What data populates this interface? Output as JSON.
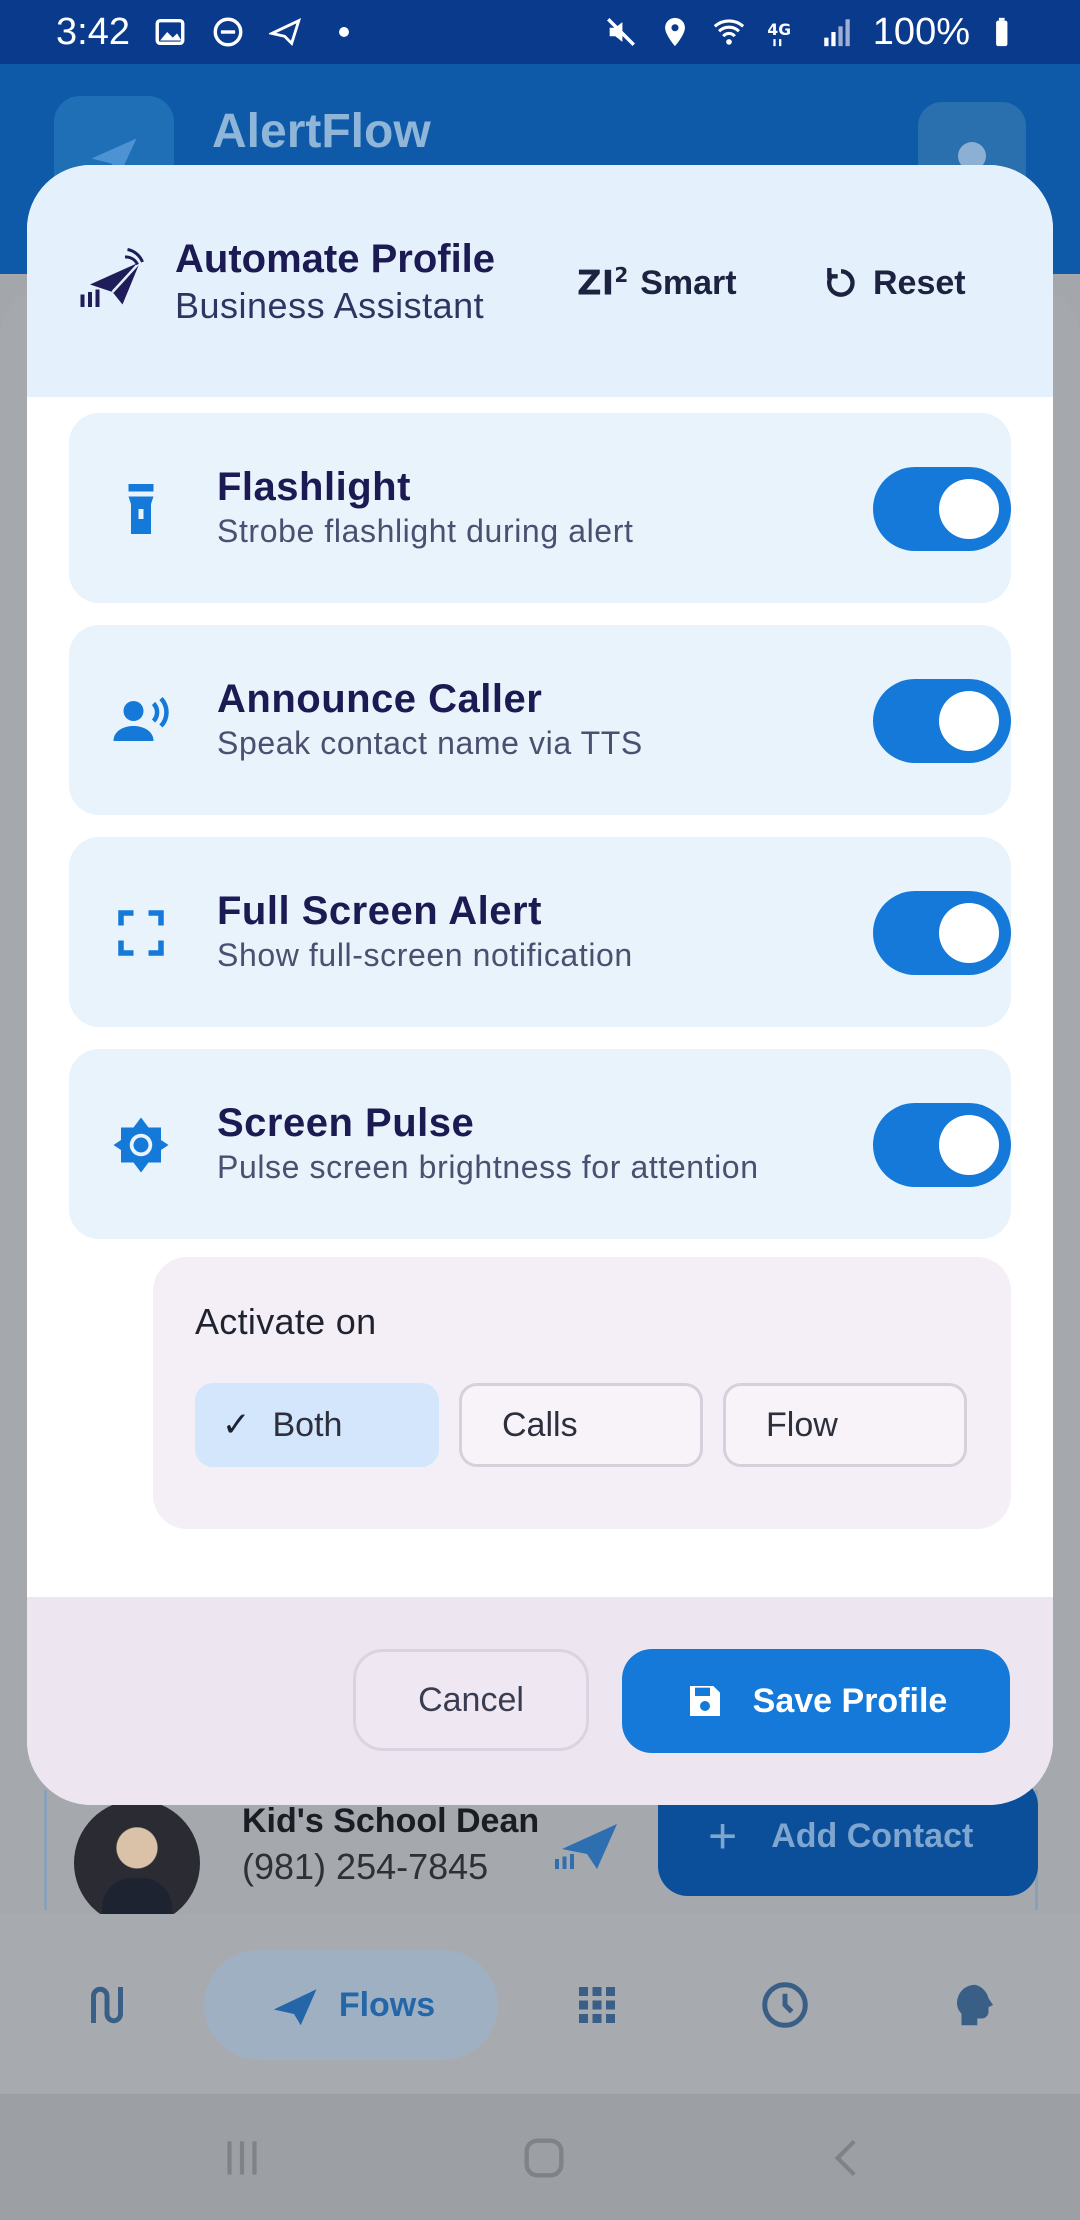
{
  "status_bar": {
    "time": "3:42",
    "battery": "100%",
    "left_icons": [
      "gallery-icon",
      "dnd-icon",
      "plane-app-icon",
      "dot-icon"
    ],
    "right_icons": [
      "mute-icon",
      "location-icon",
      "wifi-icon",
      "lte-icon",
      "signal-icon",
      "battery-icon"
    ]
  },
  "app": {
    "title": "AlertFlow"
  },
  "dialog": {
    "title": "Automate Profile",
    "subtitle": "Business Assistant",
    "smart_mark": "ZI",
    "smart_sup": "2",
    "smart_label": "Smart",
    "reset_label": "Reset",
    "features": [
      {
        "title": "Flashlight",
        "description": "Strobe flashlight during alert",
        "enabled": true,
        "icon": "flashlight-icon"
      },
      {
        "title": "Announce Caller",
        "description": "Speak contact name via TTS",
        "enabled": true,
        "icon": "speaker-person-icon"
      },
      {
        "title": "Full Screen Alert",
        "description": "Show full-screen notification",
        "enabled": true,
        "icon": "fullscreen-icon"
      },
      {
        "title": "Screen Pulse",
        "description": "Pulse screen brightness for attention",
        "enabled": true,
        "icon": "brightness-icon"
      }
    ],
    "activate": {
      "label": "Activate on",
      "options": [
        "Both",
        "Calls",
        "Flow"
      ],
      "selected": "Both"
    },
    "cancel_label": "Cancel",
    "save_label": "Save Profile"
  },
  "background": {
    "contact_name": "Kid's School Dean",
    "contact_phone": "(981) 254-7845",
    "fab_label": "Add Contact",
    "nav_active_label": "Flows"
  },
  "colors": {
    "accent": "#1479d8",
    "header_bg": "#e4f1fc",
    "card_bg": "#e9f3fc",
    "title_text": "#1c1a52"
  }
}
